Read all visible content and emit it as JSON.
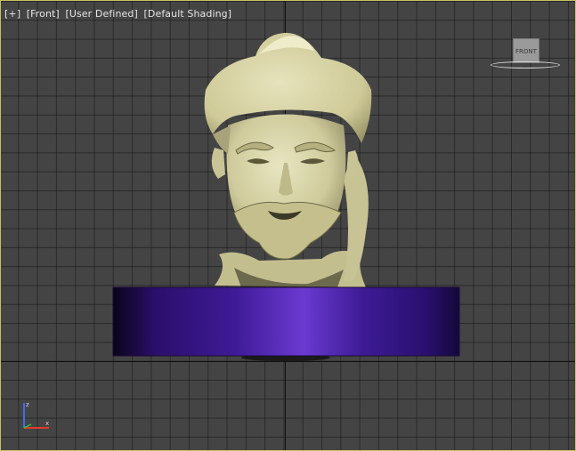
{
  "viewport": {
    "label_plus": "[+]",
    "label_view": "[Front]",
    "label_camera": "[User Defined]",
    "label_shading": "[Default Shading]",
    "border_color": "#c8c064",
    "grid_color": "#444444"
  },
  "viewcube": {
    "face_label": "FRONT"
  },
  "scene": {
    "head_color": "#d6d2a4",
    "pedestal_color": "#4a1a9a"
  },
  "icons": {
    "axis_gizmo": "xyz-axis-icon"
  }
}
